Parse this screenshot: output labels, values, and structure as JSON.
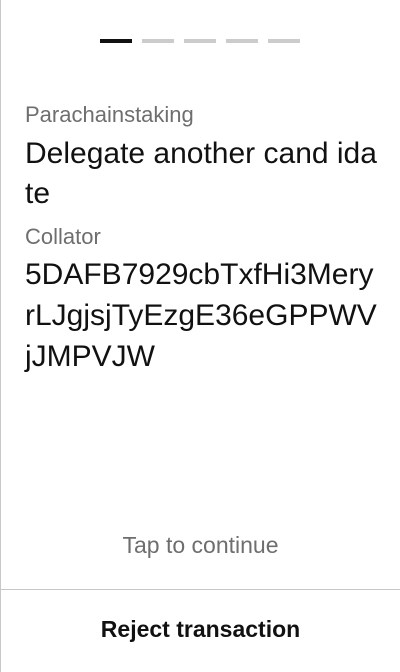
{
  "pager": {
    "total_pages": 5,
    "current_page": 1
  },
  "transaction": {
    "section": "Parachainstaking",
    "method": "Delegate another cand idate",
    "field_label": "Collator",
    "field_value": "5DAFB7929cbTxfHi3MeryrLJgjsjTyEzgE36eGPPWVjJMPVJW"
  },
  "footer": {
    "tap_hint": "Tap to continue",
    "reject_label": "Reject transaction"
  }
}
